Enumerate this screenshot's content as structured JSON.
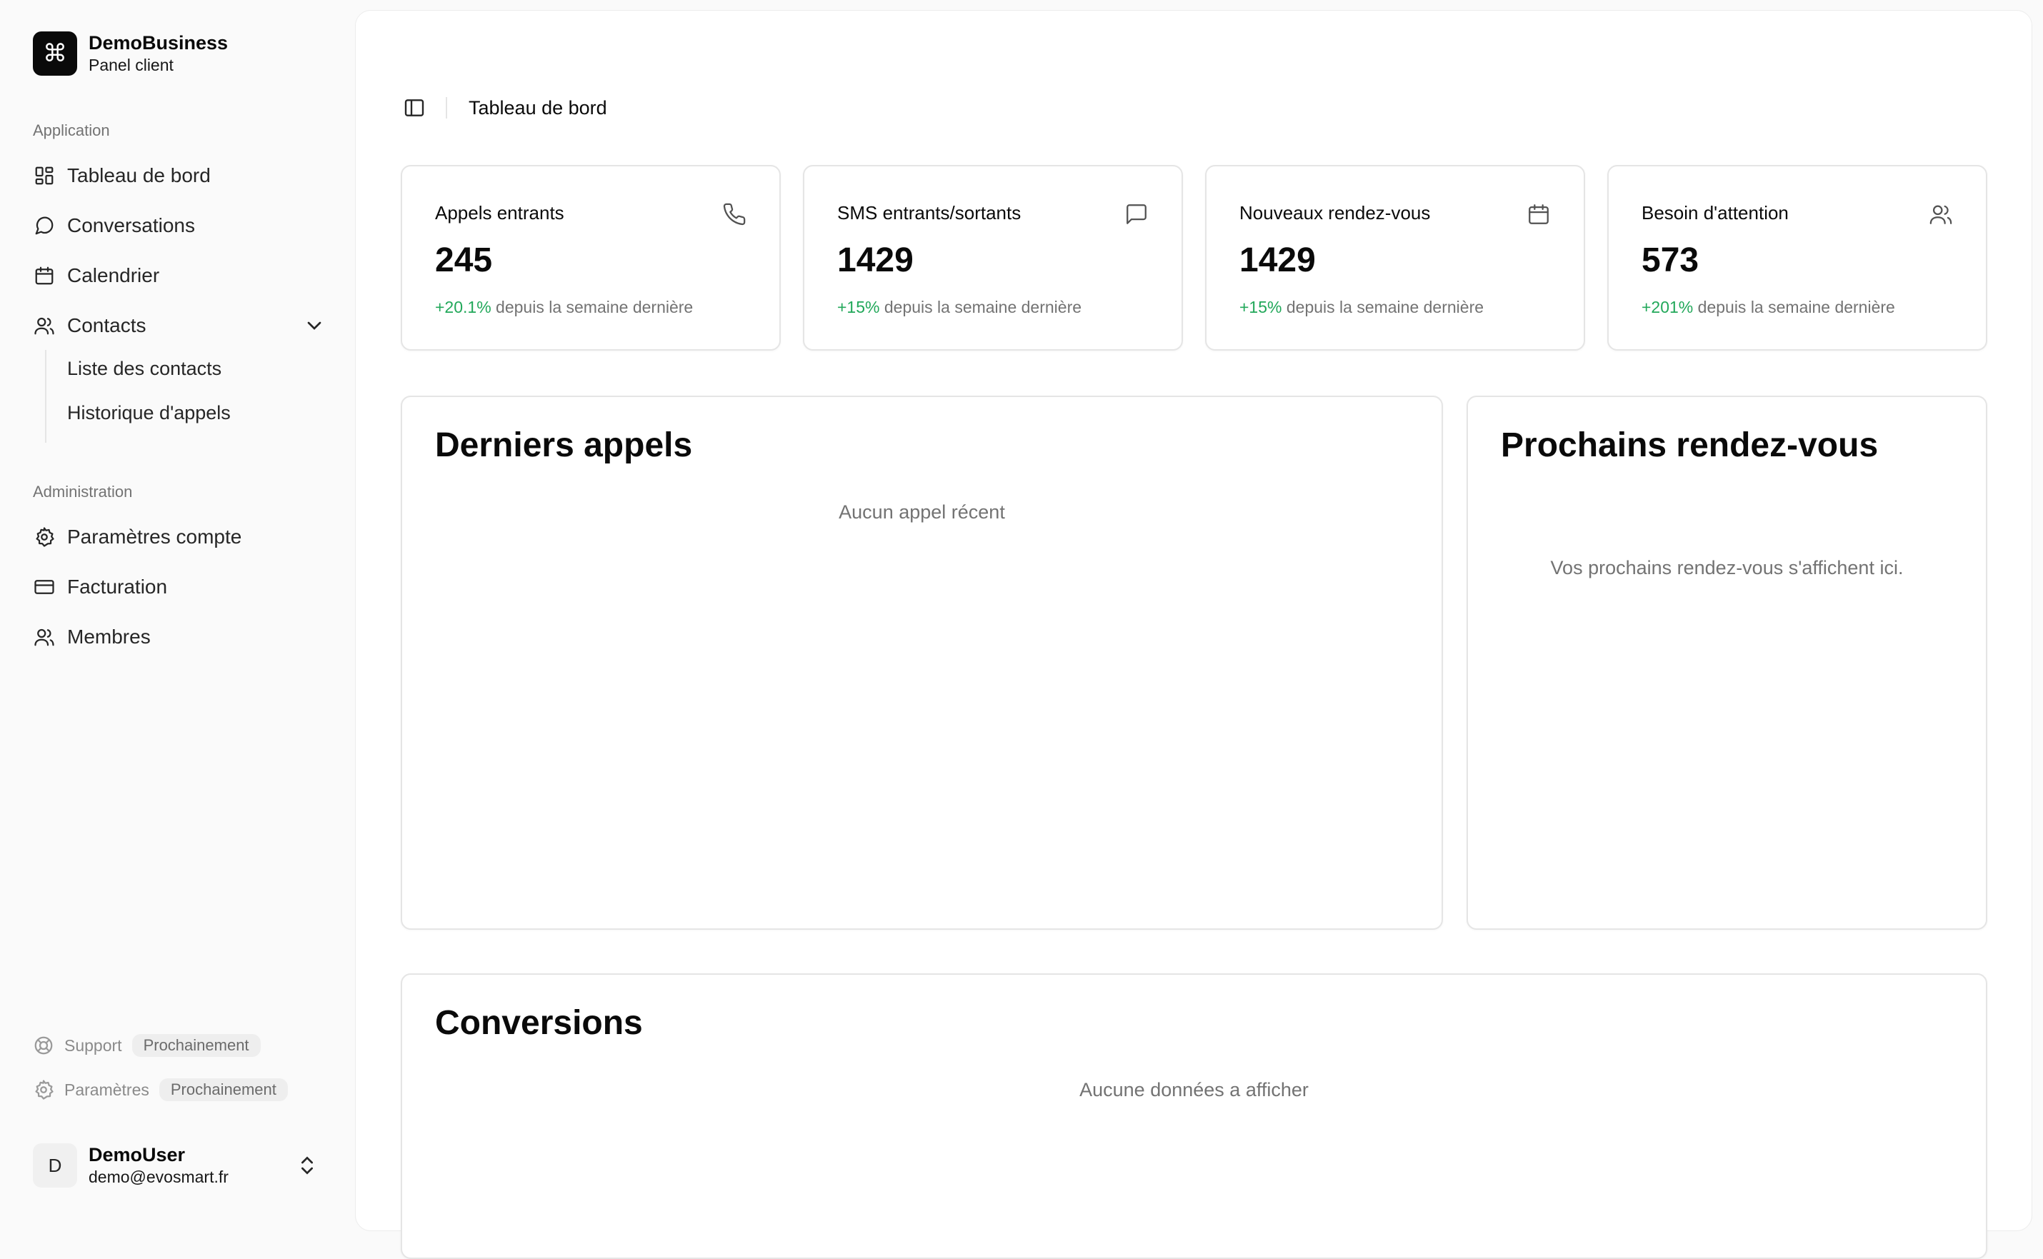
{
  "brand": {
    "name": "DemoBusiness",
    "subtitle": "Panel client",
    "logo_glyph": "⌘"
  },
  "sidebar": {
    "group_application": "Application",
    "items": [
      {
        "label": "Tableau de bord",
        "icon": "dashboard-icon"
      },
      {
        "label": "Conversations",
        "icon": "message-circle-icon"
      },
      {
        "label": "Calendrier",
        "icon": "calendar-icon"
      },
      {
        "label": "Contacts",
        "icon": "users-icon",
        "expanded": true
      }
    ],
    "contacts_sub": [
      {
        "label": "Liste des contacts"
      },
      {
        "label": "Historique d'appels"
      }
    ],
    "group_admin": "Administration",
    "admin_items": [
      {
        "label": "Paramètres compte",
        "icon": "gear-icon"
      },
      {
        "label": "Facturation",
        "icon": "credit-card-icon"
      },
      {
        "label": "Membres",
        "icon": "users-icon"
      }
    ],
    "footer": [
      {
        "label": "Support",
        "badge": "Prochainement",
        "icon": "life-buoy-icon"
      },
      {
        "label": "Paramètres",
        "badge": "Prochainement",
        "icon": "gear-icon"
      }
    ]
  },
  "user": {
    "initial": "D",
    "name": "DemoUser",
    "email": "demo@evosmart.fr"
  },
  "header": {
    "breadcrumb": "Tableau de bord"
  },
  "stats": [
    {
      "title": "Appels entrants",
      "value": "245",
      "change": "+20.1%",
      "suffix": "depuis la semaine dernière",
      "icon": "phone-icon"
    },
    {
      "title": "SMS entrants/sortants",
      "value": "1429",
      "change": "+15%",
      "suffix": "depuis la semaine dernière",
      "icon": "message-square-icon"
    },
    {
      "title": "Nouveaux rendez-vous",
      "value": "1429",
      "change": "+15%",
      "suffix": "depuis la semaine dernière",
      "icon": "calendar-icon"
    },
    {
      "title": "Besoin d'attention",
      "value": "573",
      "change": "+201%",
      "suffix": "depuis la semaine dernière",
      "icon": "users-icon"
    }
  ],
  "recent_calls": {
    "title": "Derniers appels",
    "empty": "Aucun appel récent"
  },
  "appointments": {
    "title": "Prochains rendez-vous",
    "empty": "Vos prochains rendez-vous s'affichent ici."
  },
  "conversions": {
    "title": "Conversions",
    "empty": "Aucune données a afficher"
  },
  "colors": {
    "positive": "#22a85a",
    "muted": "#737373",
    "border": "#e5e5e5"
  }
}
